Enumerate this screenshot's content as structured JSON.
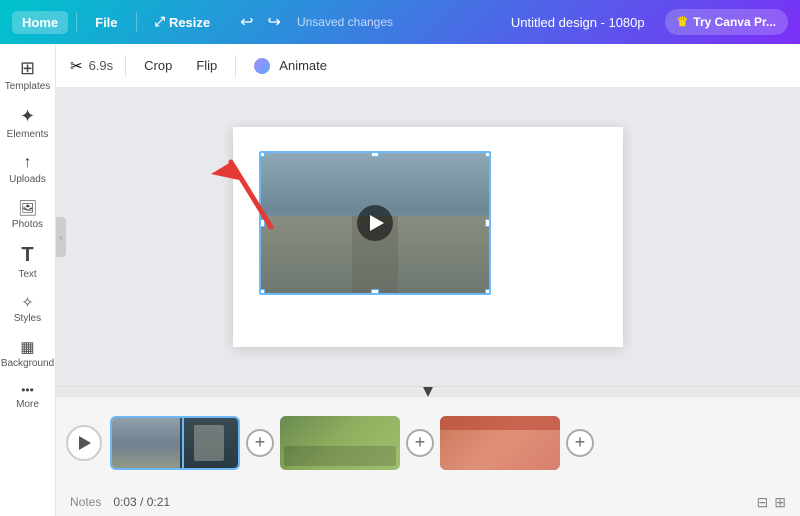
{
  "topbar": {
    "home_label": "Home",
    "file_label": "File",
    "resize_label": "Resize",
    "unsaved_label": "Unsaved changes",
    "title_label": "Untitled design - 1080p",
    "try_canva_label": "Try Canva Pr..."
  },
  "toolbar": {
    "duration_label": "6.9s",
    "crop_label": "Crop",
    "flip_label": "Flip",
    "animate_label": "Animate"
  },
  "sidebar": {
    "items": [
      {
        "label": "Templates",
        "icon": "⊞"
      },
      {
        "label": "Elements",
        "icon": "✦"
      },
      {
        "label": "Uploads",
        "icon": "↑"
      },
      {
        "label": "Photos",
        "icon": "🖼"
      },
      {
        "label": "Text",
        "icon": "T"
      },
      {
        "label": "Styles",
        "icon": "✧"
      },
      {
        "label": "Background",
        "icon": "▦"
      },
      {
        "label": "More",
        "icon": "•••"
      }
    ]
  },
  "timeline": {
    "notes_label": "Notes",
    "time_label": "0:03 / 0:21"
  },
  "colors": {
    "accent": "#6db8f7",
    "primary": "#7b2ff7",
    "gradient_start": "#00c4cc",
    "gradient_end": "#7b2ff7"
  }
}
